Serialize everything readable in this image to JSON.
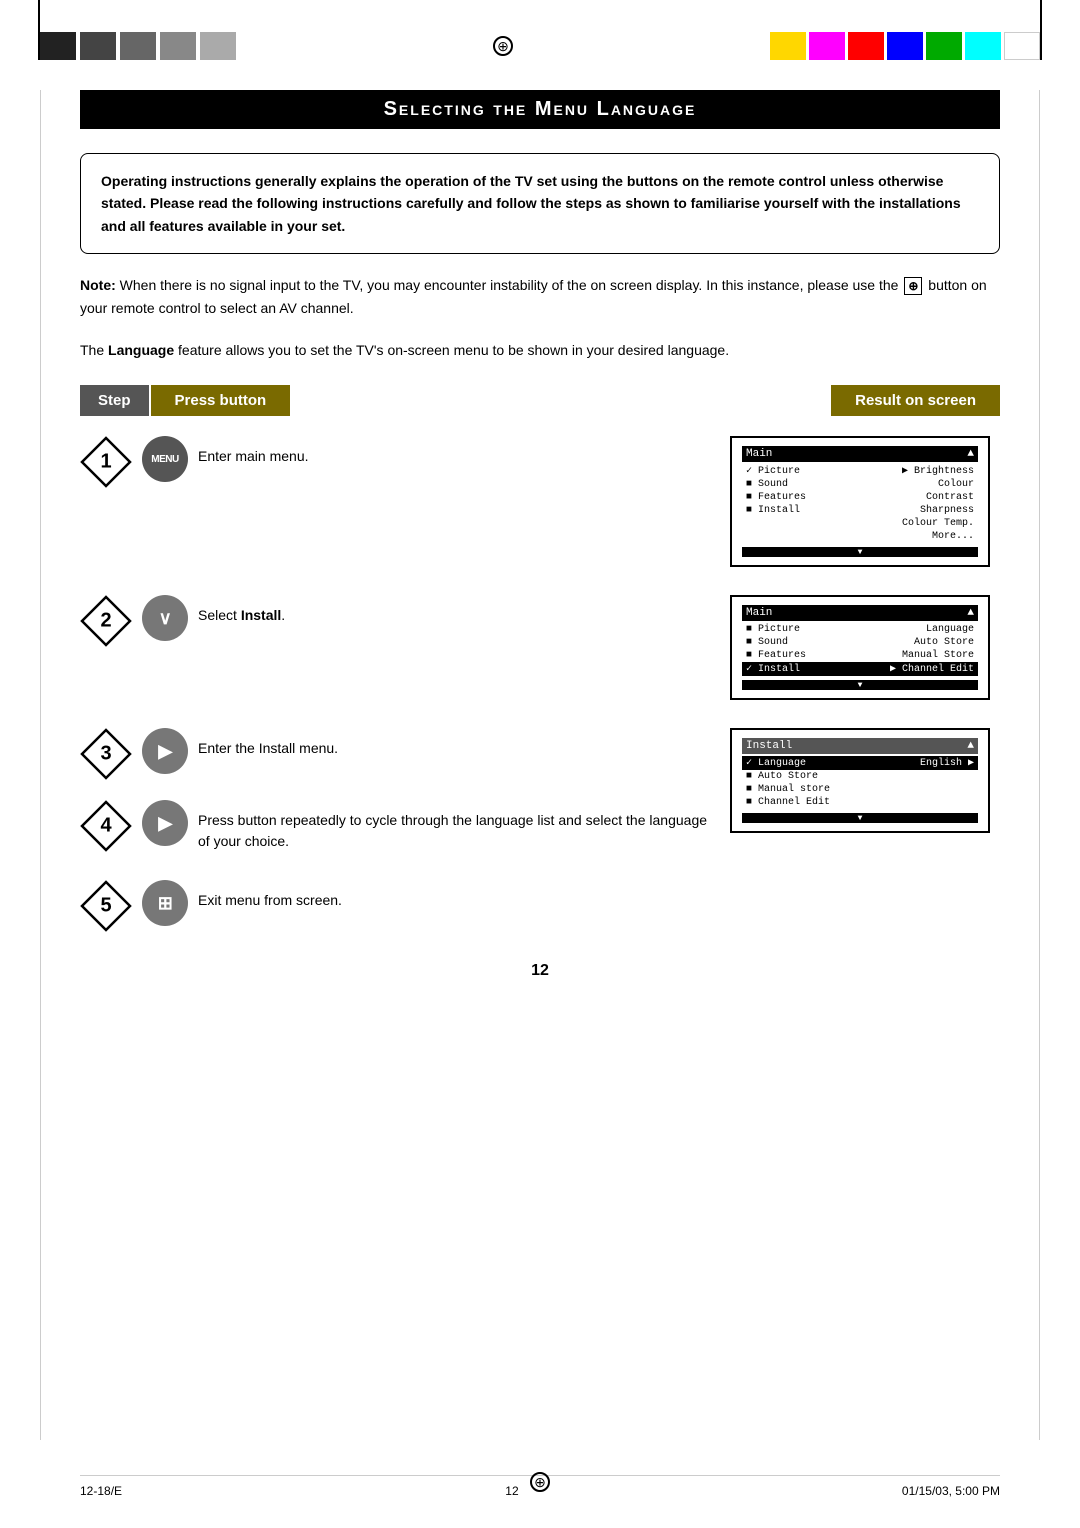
{
  "page": {
    "title": "Selecting the Menu Language",
    "title_display": "S",
    "title_rest": "ELECTING THE ",
    "title_m": "M",
    "title_rest2": "ENU ",
    "title_l": "L",
    "title_rest3": "ANGUAGE",
    "number": "12",
    "footer_left": "12-18/E",
    "footer_center": "12",
    "footer_right": "01/15/03, 5:00 PM"
  },
  "notice": {
    "text": "Operating instructions generally explains the operation of the TV set using the buttons on the remote control unless otherwise stated. Please read the following instructions carefully and follow the steps as shown to familiarise yourself with the installations and all features available in your set."
  },
  "note": {
    "label": "Note:",
    "text": "When there is no signal input to the TV, you may encounter instability of the on screen display. In this instance, please use the",
    "button_symbol": "⊕",
    "text2": "button on your remote control to select an AV channel."
  },
  "intro": {
    "feature_label": "Language",
    "text1": "The",
    "text2": "feature allows you to set the TV's on-screen menu to be shown in your desired language."
  },
  "table_headers": {
    "step": "Step",
    "press": "Press button",
    "result": "Result on screen"
  },
  "steps": [
    {
      "num": "1",
      "button_label": "MENU",
      "button_type": "menu",
      "description": "Enter main menu.",
      "screen": {
        "title": "Main",
        "rows": [
          {
            "label": "✓ Picture",
            "value": "▶  Brightness",
            "selected": false,
            "checked": true
          },
          {
            "label": "■ Sound",
            "value": "   Colour",
            "selected": false
          },
          {
            "label": "■ Features",
            "value": "   Contrast",
            "selected": false
          },
          {
            "label": "■ Install",
            "value": "   Sharpness",
            "selected": false
          },
          {
            "label": "",
            "value": "   Colour Temp.",
            "selected": false
          },
          {
            "label": "",
            "value": "   More...",
            "selected": false
          }
        ],
        "show": true
      }
    },
    {
      "num": "2",
      "button_label": "∨",
      "button_type": "down",
      "description": "Select Install.",
      "description_bold": "Install",
      "screen": {
        "title": "Main",
        "rows": [
          {
            "label": "■ Picture",
            "value": "Language"
          },
          {
            "label": "■ Sound",
            "value": "Auto Store"
          },
          {
            "label": "■ Features",
            "value": "Manual Store"
          },
          {
            "label": "✓ Install",
            "value": "▶  Channel Edit",
            "selected": true
          }
        ],
        "show": true
      }
    },
    {
      "num": "3",
      "button_label": "▶",
      "button_type": "right",
      "description": "Enter the Install menu.",
      "screen": {
        "title": "Install",
        "rows": [
          {
            "label": "✓ Language",
            "value": "English  ▶",
            "selected": true
          },
          {
            "label": "■ Auto Store",
            "value": ""
          },
          {
            "label": "■ Manual store",
            "value": ""
          },
          {
            "label": "■ Channel Edit",
            "value": ""
          }
        ],
        "show": true
      }
    },
    {
      "num": "4",
      "button_label": "▶",
      "button_type": "right",
      "description": "Press button repeatedly to cycle through the language list and select the language of your choice.",
      "screen": {
        "show": false
      }
    },
    {
      "num": "5",
      "button_label": "⊞",
      "button_type": "exit",
      "description": "Exit menu from screen.",
      "screen": {
        "show": false
      }
    }
  ]
}
